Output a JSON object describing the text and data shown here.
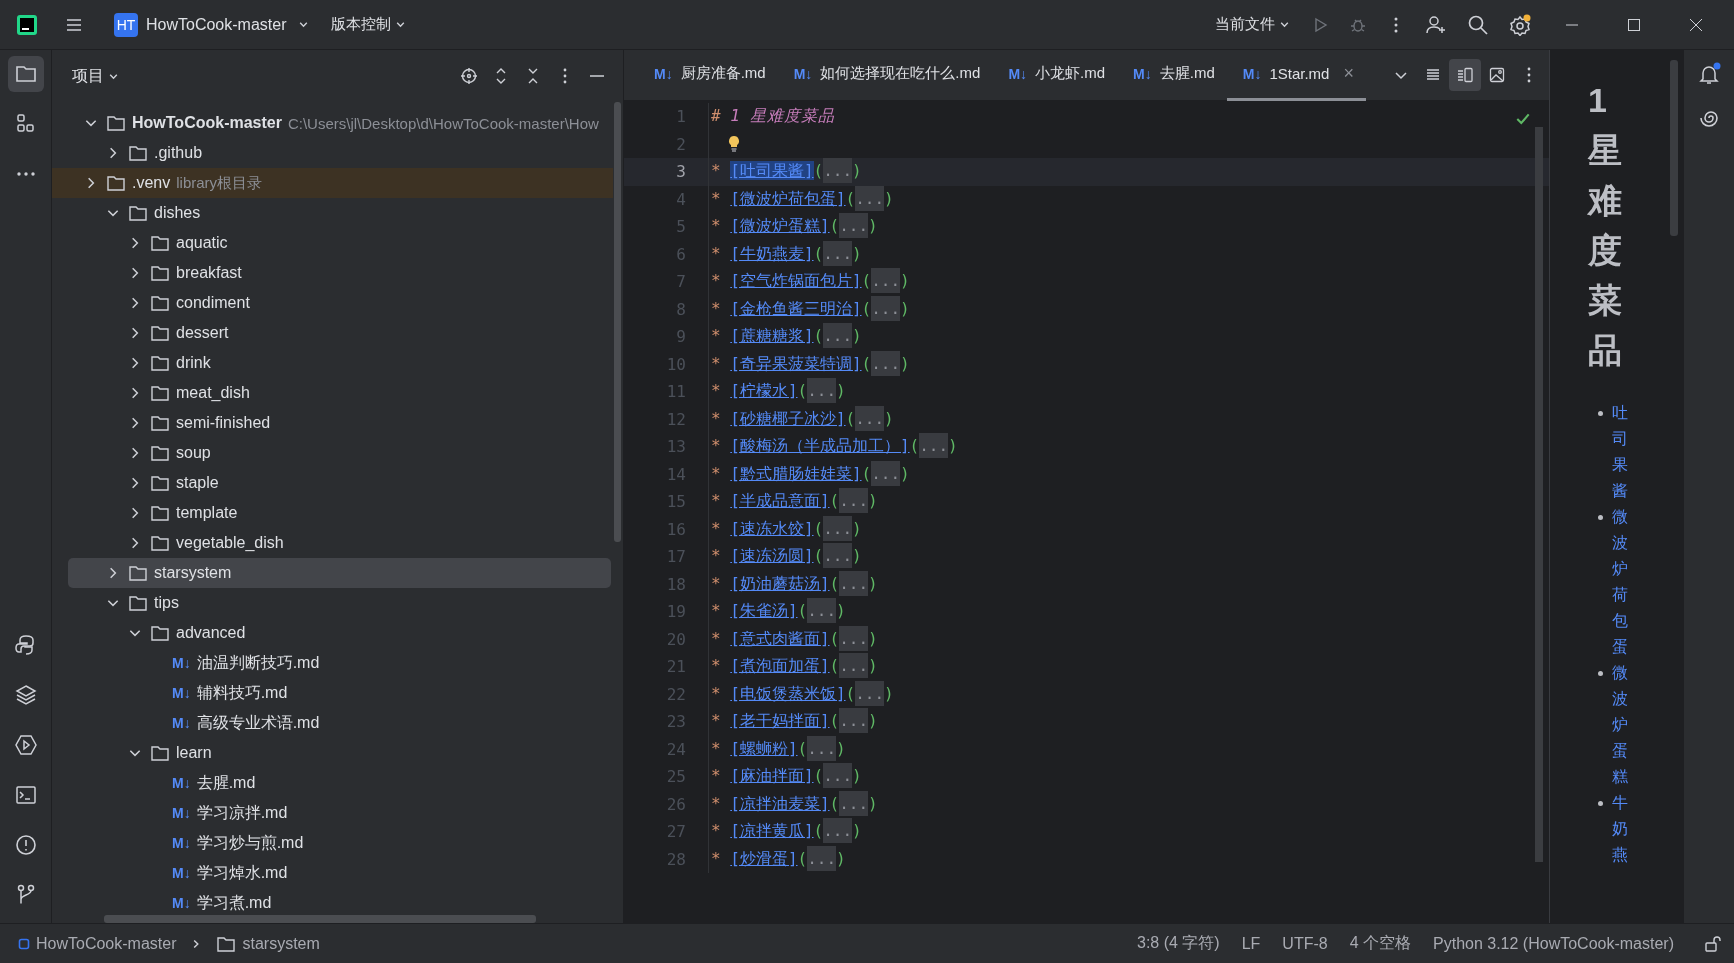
{
  "titlebar": {
    "project_badge": "HT",
    "project": "HowToCook-master",
    "vcs": "版本控制",
    "run_config": "当前文件",
    "settings_notification": true
  },
  "project_panel": {
    "title": "项目",
    "tree": [
      {
        "label": "HowToCook-master",
        "kind": "root",
        "path": "C:\\Users\\jl\\Desktop\\d\\HowToCook-master\\How",
        "expanded": true,
        "selected": false,
        "children": [
          {
            "label": ".github",
            "kind": "folder",
            "expanded": false,
            "selected": false
          },
          {
            "label": ".venv",
            "kind": "library",
            "note": "library根目录",
            "expanded": false,
            "selected": false
          },
          {
            "label": "dishes",
            "kind": "folder",
            "expanded": true,
            "selected": false,
            "children": [
              {
                "label": "aquatic",
                "kind": "folder",
                "expanded": false,
                "selected": false
              },
              {
                "label": "breakfast",
                "kind": "folder",
                "expanded": false,
                "selected": false
              },
              {
                "label": "condiment",
                "kind": "folder",
                "expanded": false,
                "selected": false
              },
              {
                "label": "dessert",
                "kind": "folder",
                "expanded": false,
                "selected": false
              },
              {
                "label": "drink",
                "kind": "folder",
                "expanded": false,
                "selected": false
              },
              {
                "label": "meat_dish",
                "kind": "folder",
                "expanded": false,
                "selected": false
              },
              {
                "label": "semi-finished",
                "kind": "folder",
                "expanded": false,
                "selected": false
              },
              {
                "label": "soup",
                "kind": "folder",
                "expanded": false,
                "selected": false
              },
              {
                "label": "staple",
                "kind": "folder",
                "expanded": false,
                "selected": false
              },
              {
                "label": "template",
                "kind": "folder",
                "expanded": false,
                "selected": false
              },
              {
                "label": "vegetable_dish",
                "kind": "folder",
                "expanded": false,
                "selected": false
              }
            ]
          },
          {
            "label": "starsystem",
            "kind": "folder",
            "expanded": false,
            "selected": true
          },
          {
            "label": "tips",
            "kind": "folder",
            "expanded": true,
            "selected": false,
            "children": [
              {
                "label": "advanced",
                "kind": "folder",
                "expanded": true,
                "selected": false,
                "children": [
                  {
                    "label": "油温判断技巧.md",
                    "kind": "file",
                    "icon": "M↓",
                    "selected": false
                  },
                  {
                    "label": "辅料技巧.md",
                    "kind": "file",
                    "icon": "M↓",
                    "selected": false
                  },
                  {
                    "label": "高级专业术语.md",
                    "kind": "file",
                    "icon": "M↓",
                    "selected": false
                  }
                ]
              },
              {
                "label": "learn",
                "kind": "folder",
                "expanded": true,
                "selected": false,
                "children": [
                  {
                    "label": "去腥.md",
                    "kind": "file",
                    "icon": "M↓",
                    "selected": false
                  },
                  {
                    "label": "学习凉拌.md",
                    "kind": "file",
                    "icon": "M↓",
                    "selected": false
                  },
                  {
                    "label": "学习炒与煎.md",
                    "kind": "file",
                    "icon": "M↓",
                    "selected": false
                  },
                  {
                    "label": "学习焯水.md",
                    "kind": "file",
                    "icon": "M↓",
                    "selected": false
                  },
                  {
                    "label": "学习煮.md",
                    "kind": "file",
                    "icon": "M↓",
                    "selected": false
                  }
                ]
              }
            ]
          }
        ]
      }
    ]
  },
  "tabs": [
    {
      "icon": "M↓",
      "label": "厨房准备.md",
      "selected": false
    },
    {
      "icon": "M↓",
      "label": "如何选择现在吃什么.md",
      "selected": false
    },
    {
      "icon": "M↓",
      "label": "小龙虾.md",
      "selected": false
    },
    {
      "icon": "M↓",
      "label": "去腥.md",
      "selected": false
    },
    {
      "icon": "M↓",
      "label": "1Star.md",
      "selected": true,
      "close": "×"
    }
  ],
  "editor": {
    "lines": [
      {
        "number": "1",
        "kind": "heading",
        "marker": "#",
        "num": "1",
        "title": "星难度菜品",
        "current": false
      },
      {
        "number": "2",
        "kind": "blank",
        "hint": true,
        "current": false
      },
      {
        "number": "3",
        "kind": "link",
        "bullet": "*",
        "link": "[吐司果酱]",
        "url": "(...)",
        "current": true
      },
      {
        "number": "4",
        "kind": "link",
        "bullet": "*",
        "link": "[微波炉荷包蛋]",
        "url": "(...)",
        "current": false
      },
      {
        "number": "5",
        "kind": "link",
        "bullet": "*",
        "link": "[微波炉蛋糕]",
        "url": "(...)",
        "current": false
      },
      {
        "number": "6",
        "kind": "link",
        "bullet": "*",
        "link": "[牛奶燕麦]",
        "url": "(...)",
        "current": false
      },
      {
        "number": "7",
        "kind": "link",
        "bullet": "*",
        "link": "[空气炸锅面包片]",
        "url": "(...)",
        "current": false
      },
      {
        "number": "8",
        "kind": "link",
        "bullet": "*",
        "link": "[金枪鱼酱三明治]",
        "url": "(...)",
        "current": false
      },
      {
        "number": "9",
        "kind": "link",
        "bullet": "*",
        "link": "[蔗糖糖浆]",
        "url": "(...)",
        "current": false
      },
      {
        "number": "10",
        "kind": "link",
        "bullet": "*",
        "link": "[奇异果菠菜特调]",
        "url": "(...)",
        "current": false
      },
      {
        "number": "11",
        "kind": "link",
        "bullet": "*",
        "link": "[柠檬水]",
        "url": "(...)",
        "current": false
      },
      {
        "number": "12",
        "kind": "link",
        "bullet": "*",
        "link": "[砂糖椰子冰沙]",
        "url": "(...)",
        "current": false
      },
      {
        "number": "13",
        "kind": "link",
        "bullet": "*",
        "link": "[酸梅汤（半成品加工）]",
        "url": "(...)",
        "current": false
      },
      {
        "number": "14",
        "kind": "link",
        "bullet": "*",
        "link": "[黔式腊肠娃娃菜]",
        "url": "(...)",
        "current": false
      },
      {
        "number": "15",
        "kind": "link",
        "bullet": "*",
        "link": "[半成品意面]",
        "url": "(...)",
        "current": false
      },
      {
        "number": "16",
        "kind": "link",
        "bullet": "*",
        "link": "[速冻水饺]",
        "url": "(...)",
        "current": false
      },
      {
        "number": "17",
        "kind": "link",
        "bullet": "*",
        "link": "[速冻汤圆]",
        "url": "(...)",
        "current": false
      },
      {
        "number": "18",
        "kind": "link",
        "bullet": "*",
        "link": "[奶油蘑菇汤]",
        "url": "(...)",
        "current": false
      },
      {
        "number": "19",
        "kind": "link",
        "bullet": "*",
        "link": "[朱雀汤]",
        "url": "(...)",
        "current": false
      },
      {
        "number": "20",
        "kind": "link",
        "bullet": "*",
        "link": "[意式肉酱面]",
        "url": "(...)",
        "current": false
      },
      {
        "number": "21",
        "kind": "link",
        "bullet": "*",
        "link": "[煮泡面加蛋]",
        "url": "(...)",
        "current": false
      },
      {
        "number": "22",
        "kind": "link",
        "bullet": "*",
        "link": "[电饭煲蒸米饭]",
        "url": "(...)",
        "current": false
      },
      {
        "number": "23",
        "kind": "link",
        "bullet": "*",
        "link": "[老干妈拌面]",
        "url": "(...)",
        "current": false
      },
      {
        "number": "24",
        "kind": "link",
        "bullet": "*",
        "link": "[螺蛳粉]",
        "url": "(...)",
        "current": false
      },
      {
        "number": "25",
        "kind": "link",
        "bullet": "*",
        "link": "[麻油拌面]",
        "url": "(...)",
        "current": false
      },
      {
        "number": "26",
        "kind": "link",
        "bullet": "*",
        "link": "[凉拌油麦菜]",
        "url": "(...)",
        "current": false
      },
      {
        "number": "27",
        "kind": "link",
        "bullet": "*",
        "link": "[凉拌黄瓜]",
        "url": "(...)",
        "current": false
      },
      {
        "number": "28",
        "kind": "link",
        "bullet": "*",
        "link": "[炒滑蛋]",
        "url": "(...)",
        "current": false
      }
    ]
  },
  "preview": {
    "heading": "1 星难度菜品",
    "items": [
      "吐司果酱",
      "微波炉荷包蛋",
      "微波炉蛋糕",
      "牛奶燕"
    ]
  },
  "status_bar": {
    "breadcrumb": [
      "HowToCook-master",
      "starsystem"
    ],
    "items": [
      "3:8 (4 字符)",
      "LF",
      "UTF-8",
      "4 个空格",
      "Python 3.12 (HowToCook-master)"
    ]
  }
}
